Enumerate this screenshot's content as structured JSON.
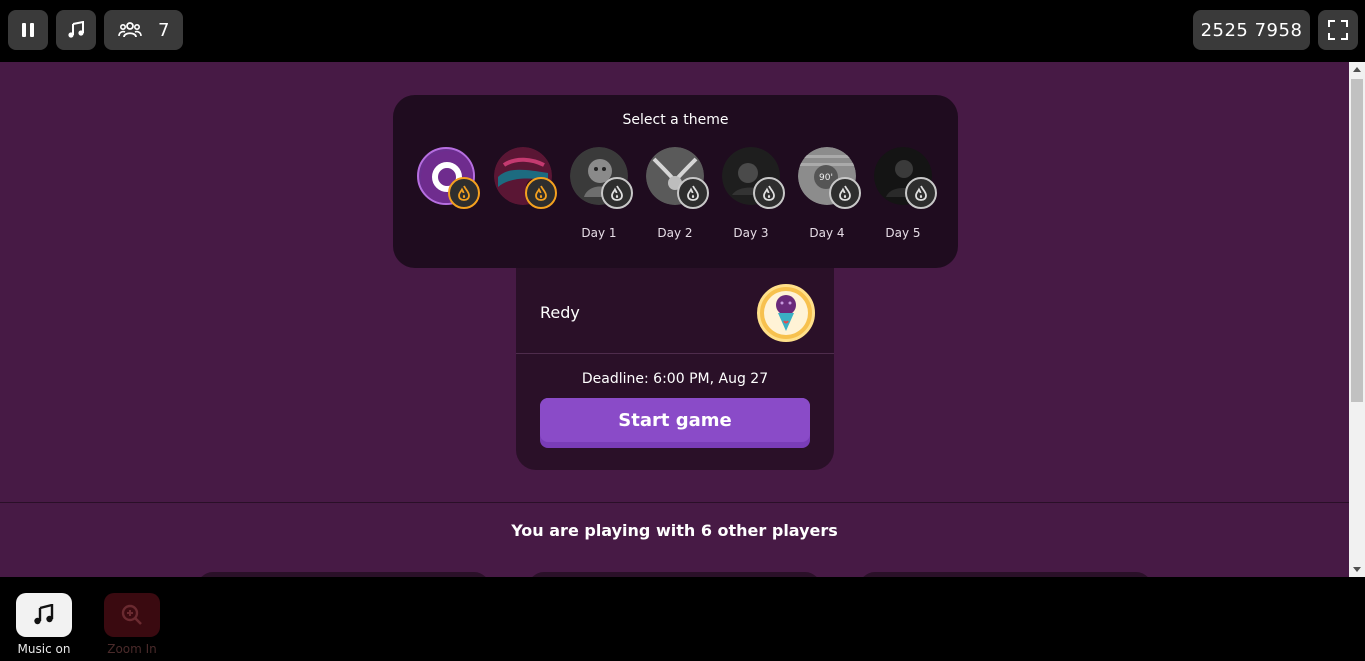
{
  "topbar": {
    "pause_icon": "pause-icon",
    "music_icon": "music-note-icon",
    "players_icon": "users-icon",
    "players_count": "7",
    "game_code": "2525 7958",
    "fullscreen_icon": "fullscreen-icon"
  },
  "theme_panel": {
    "title": "Select a theme",
    "themes": [
      {
        "label": "",
        "selected": true,
        "badge": "gold",
        "icon": "flame-icon"
      },
      {
        "label": "",
        "selected": false,
        "badge": "gold",
        "icon": "flame-icon"
      },
      {
        "label": "Day 1",
        "selected": false,
        "badge": "grey",
        "icon": "flame-icon"
      },
      {
        "label": "Day 2",
        "selected": false,
        "badge": "grey",
        "icon": "flame-icon"
      },
      {
        "label": "Day 3",
        "selected": false,
        "badge": "grey",
        "icon": "flame-icon"
      },
      {
        "label": "Day 4",
        "selected": false,
        "badge": "grey",
        "icon": "flame-icon"
      },
      {
        "label": "Day 5",
        "selected": false,
        "badge": "grey",
        "icon": "flame-icon"
      }
    ]
  },
  "player_card": {
    "name": "Redy",
    "avatar_icon": "microphone-avatar-icon",
    "deadline": "Deadline: 6:00 PM, Aug 27",
    "start_label": "Start game"
  },
  "players_section": {
    "text": "You are playing with 6 other players"
  },
  "bottombar": {
    "music_label": "Music on",
    "zoom_label": "Zoom In"
  },
  "colors": {
    "background": "#471a45",
    "panel": "#1f0c1f",
    "card": "#2a1028",
    "accent": "#8a4bc8",
    "badge_gold": "#f4a11f"
  }
}
